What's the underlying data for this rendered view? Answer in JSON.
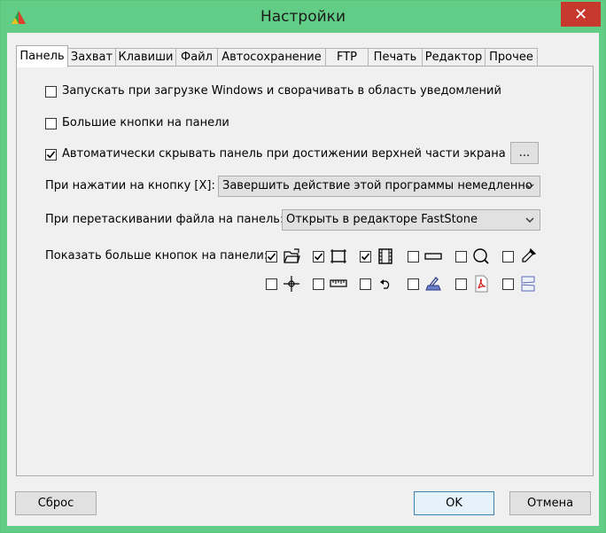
{
  "window": {
    "title": "Настройки"
  },
  "tabs": [
    "Панель",
    "Захват",
    "Клавиши",
    "Файл",
    "Автосохранение",
    "FTP",
    "Печать",
    "Редактор",
    "Прочее"
  ],
  "options": {
    "startup": {
      "label": "Запускать при загрузке Windows и сворачивать в область уведомлений",
      "checked": false
    },
    "large_buttons": {
      "label": "Большие кнопки на панели",
      "checked": false
    },
    "autohide": {
      "label": "Автоматически скрывать панель при достижении верхней части экрана",
      "checked": true,
      "more_label": "..."
    }
  },
  "close_action": {
    "label": "При нажатии на кнопку [X]:",
    "value": "Завершить действие этой программы немедленно"
  },
  "drag_action": {
    "label": "При перетаскивании файла на панель:",
    "value": "Открыть в редакторе FastStone"
  },
  "extra_buttons": {
    "label": "Показать больше кнопок на панели:",
    "row1": [
      {
        "icon": "open-folder-icon",
        "checked": true
      },
      {
        "icon": "capture-window-icon",
        "checked": true
      },
      {
        "icon": "video-film-icon",
        "checked": true
      },
      {
        "icon": "rectangle-icon",
        "checked": false
      },
      {
        "icon": "magnifier-icon",
        "checked": false
      },
      {
        "icon": "color-picker-icon",
        "checked": false
      }
    ],
    "row2": [
      {
        "icon": "crosshair-icon",
        "checked": false
      },
      {
        "icon": "ruler-icon",
        "checked": false
      },
      {
        "icon": "undo-arrow-icon",
        "checked": false
      },
      {
        "icon": "scanner-icon",
        "checked": false
      },
      {
        "icon": "pdf-icon",
        "checked": false
      },
      {
        "icon": "split-page-icon",
        "checked": false
      }
    ]
  },
  "footer": {
    "reset_label": "Сброс",
    "ok_label": "OK",
    "cancel_label": "Отмена"
  }
}
